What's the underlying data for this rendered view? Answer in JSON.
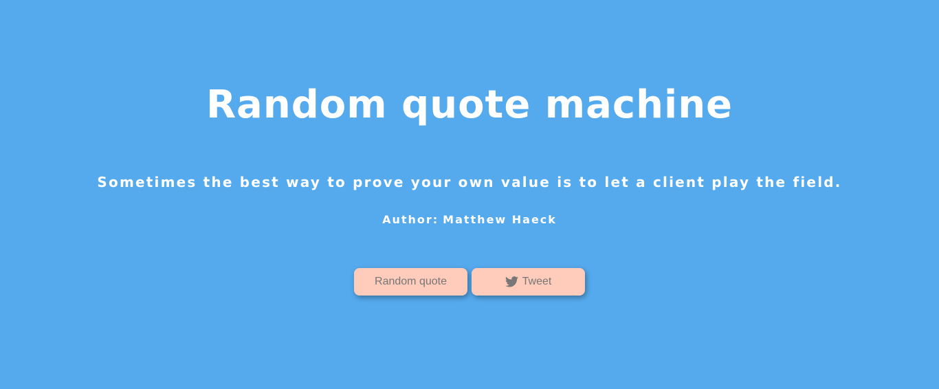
{
  "page": {
    "title": "Random quote machine",
    "quote": "Sometimes the best way to prove your own value is to let a client play the field.",
    "author_label": "Author:",
    "author_name": "Matthew Haeck"
  },
  "buttons": {
    "random_quote_label": "Random quote",
    "tweet_label": "Tweet",
    "tweet_icon": "twitter-icon"
  },
  "colors": {
    "background": "#55aaee",
    "button_bg": "#ffcbbb",
    "button_text": "#777777",
    "text": "#ffffff"
  }
}
